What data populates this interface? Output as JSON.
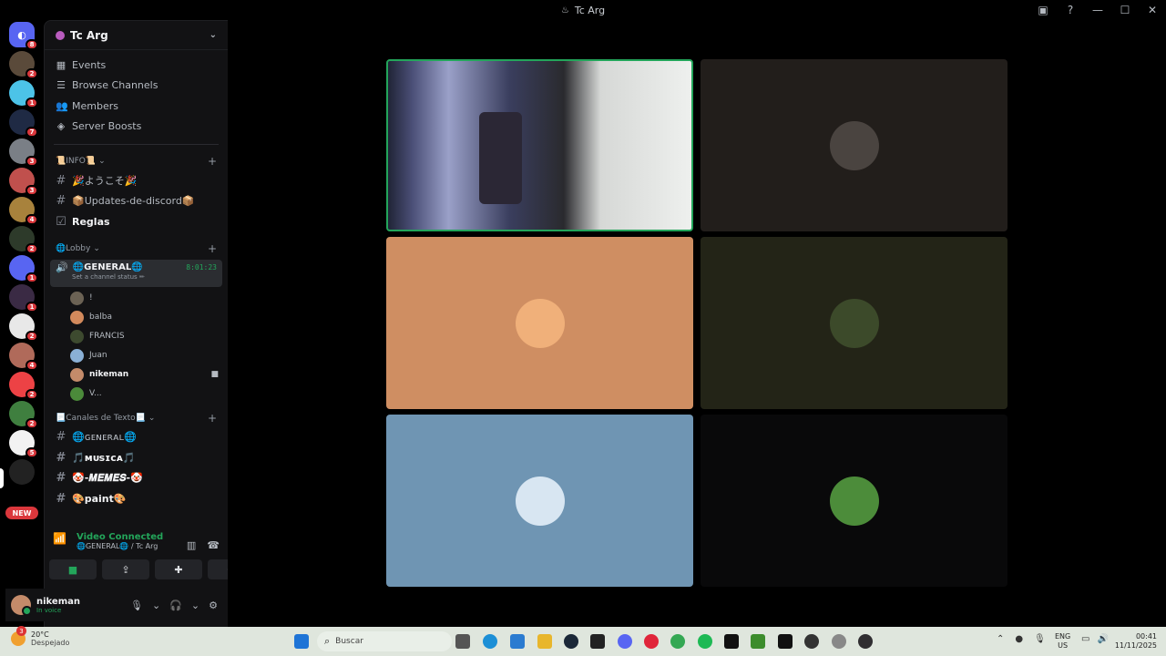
{
  "window": {
    "title": "Tc Arg"
  },
  "server": {
    "name": "Tc Arg"
  },
  "menu": [
    {
      "icon": "calendar-icon",
      "label": "Events"
    },
    {
      "icon": "browse-icon",
      "label": "Browse Channels"
    },
    {
      "icon": "members-icon",
      "label": "Members"
    },
    {
      "icon": "boost-icon",
      "label": "Server Boosts"
    }
  ],
  "categories": {
    "info": "📜INFO📜",
    "lobby": "🌐Lobby",
    "text": "📃Canales de Texto📃"
  },
  "info_channels": [
    {
      "label": "🎉ようこそ🎉",
      "bold": false
    },
    {
      "label": "📦Updates-de-discord📦",
      "bold": false
    },
    {
      "label": "Reglas",
      "bold": true
    }
  ],
  "voice_channel": {
    "name": "🌐GENERAL🌐",
    "timer": "8:01:23",
    "status": "Set a channel status ✏"
  },
  "voice_users": [
    {
      "name": "!",
      "color": "#6b6254"
    },
    {
      "name": "balba",
      "color": "#d38a5c"
    },
    {
      "name": "FRANCIS",
      "color": "#3d4a2f"
    },
    {
      "name": "Juan",
      "color": "#8ab0d6"
    },
    {
      "name": "nikeman",
      "color": "#c48b6a",
      "me": true
    },
    {
      "name": "V...",
      "color": "#4b8a3a"
    }
  ],
  "text_channels": [
    {
      "label": "🌐ɢᴇɴᴇʀᴀʟ🌐"
    },
    {
      "label": "🎵ᴍᴜꜱɪᴄᴀ🎵"
    },
    {
      "label": "🤡-𝑴𝑬𝑴𝑬𝑺-🤡"
    },
    {
      "label": "🎨paint🎨"
    }
  ],
  "voice_panel": {
    "status": "Video Connected",
    "location": "🌐GENERAL🌐 / Tc Arg"
  },
  "user": {
    "name": "nikeman",
    "status": "In voice"
  },
  "servers": [
    {
      "badge": "8",
      "color": "#5865f2"
    },
    {
      "badge": "2",
      "color": "#5a4a3a"
    },
    {
      "badge": "1",
      "color": "#4cc3e8"
    },
    {
      "badge": "7",
      "color": "#1f2a44"
    },
    {
      "badge": "3",
      "color": "#7a7f86"
    },
    {
      "badge": "3",
      "color": "#c0504d"
    },
    {
      "badge": "4",
      "color": "#a8823c"
    },
    {
      "badge": "2",
      "color": "#2d3a2a"
    },
    {
      "badge": "1",
      "color": "#5865f2"
    },
    {
      "badge": "1",
      "color": "#3a2a44"
    },
    {
      "badge": "2",
      "color": "#e8e8e8"
    },
    {
      "badge": "4",
      "color": "#b06a5a"
    },
    {
      "badge": "2",
      "color": "#ed4245"
    },
    {
      "badge": "2",
      "color": "#3f7f3f"
    },
    {
      "badge": "5",
      "color": "#f2f2f2"
    },
    {
      "badge": "",
      "color": "#222"
    }
  ],
  "new_label": "NEW",
  "tiles": [
    {
      "type": "video",
      "bg": "#3a3a44",
      "speaking": true
    },
    {
      "type": "avatar",
      "bg": "#221e1b",
      "avatar_color": "#4a4440"
    },
    {
      "type": "avatar",
      "bg": "#cf8e62",
      "avatar_color": "#f0b07a"
    },
    {
      "type": "avatar",
      "bg": "#232417",
      "avatar_color": "#3c4a2a"
    },
    {
      "type": "avatar",
      "bg": "#6f95b3",
      "avatar_color": "#d8e6f2"
    },
    {
      "type": "avatar",
      "bg": "#09090a",
      "avatar_color": "#4c8c3a"
    }
  ],
  "taskbar": {
    "weather_temp": "20°C",
    "weather_desc": "Despejado",
    "weather_badge": "3",
    "search_placeholder": "Buscar",
    "lang1": "ENG",
    "lang2": "US",
    "time": "00:41",
    "date": "11/11/2025"
  }
}
